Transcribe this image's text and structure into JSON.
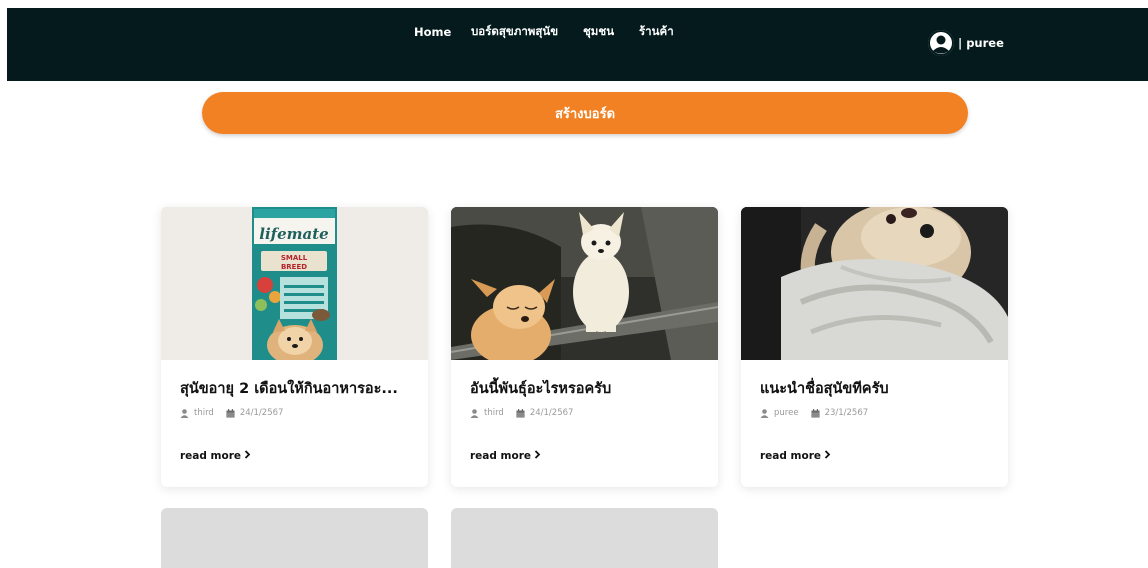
{
  "nav": {
    "links": [
      "Home",
      "บอร์ดสุขภาพสุนัข",
      "ชุมชน",
      "ร้านค้า"
    ],
    "username": "| puree"
  },
  "create_board_label": "สร้างบอร์ด",
  "cards": [
    {
      "title": "สุนัขอายุ 2 เดือนให้กินอาหารอะ...",
      "author": "third",
      "date": "24/1/2567",
      "read_more": "read more",
      "image_brand": "lifemate",
      "image_variant": "SMALL BREED"
    },
    {
      "title": "อันนี้พันธุ์อะไรหรอครับ",
      "author": "third",
      "date": "24/1/2567",
      "read_more": "read more"
    },
    {
      "title": "แนะนำชื่อสุนัขทีครับ",
      "author": "puree",
      "date": "23/1/2567",
      "read_more": "read more"
    }
  ],
  "colors": {
    "navbar": "#041a1c",
    "accent": "#f28123",
    "placeholder": "#dcdcdc"
  },
  "icons": {
    "user_avatar": "user-circle-icon",
    "author": "person-icon",
    "date": "calendar-icon",
    "read_more": "chevron-right-icon"
  }
}
